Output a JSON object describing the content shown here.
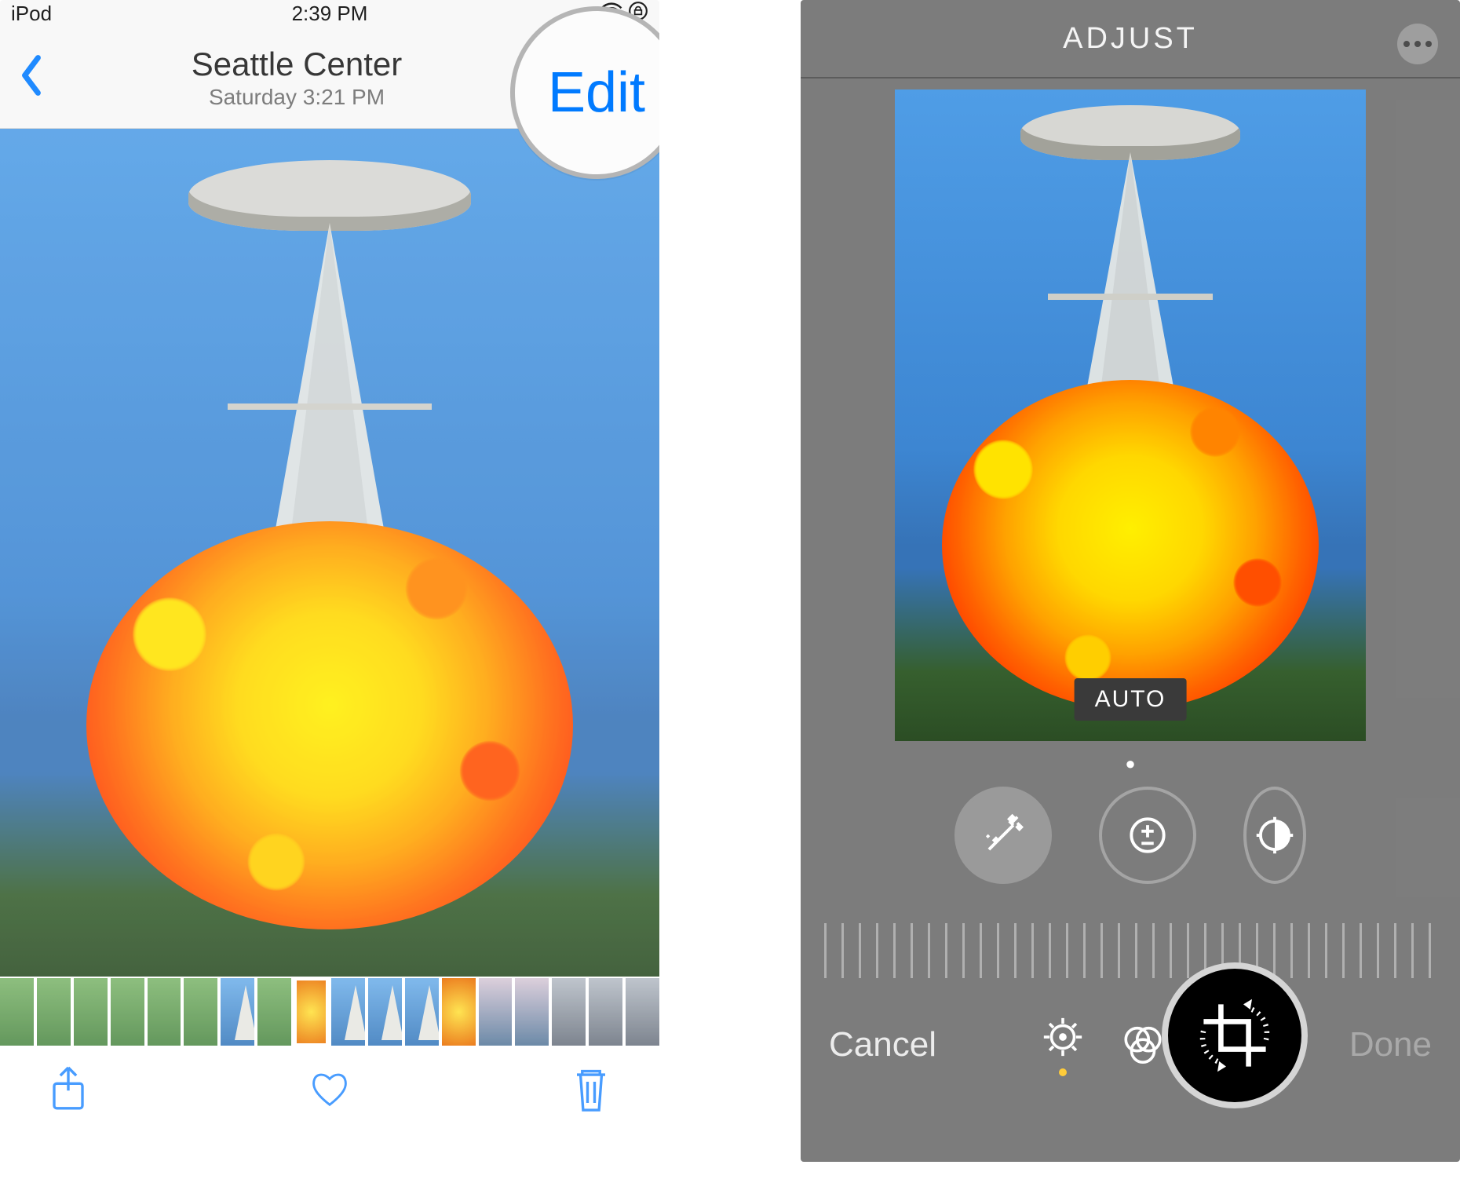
{
  "left": {
    "status": {
      "device": "iPod",
      "time": "2:39 PM"
    },
    "nav": {
      "title": "Seattle Center",
      "subtitle": "Saturday  3:21 PM",
      "edit": "Edit"
    },
    "auto_label": "",
    "thumbs_count": 18
  },
  "right": {
    "header": "ADJUST",
    "auto": "AUTO",
    "cancel": "Cancel",
    "done": "Done"
  },
  "icons": {
    "back": "chevron-left-icon",
    "wifi": "wifi-icon",
    "lock": "orientation-lock-icon",
    "share": "share-icon",
    "heart": "heart-icon",
    "trash": "trash-icon",
    "more": "more-icon",
    "wand": "magic-wand-icon",
    "exposure": "exposure-icon",
    "brightness": "brightness-icon",
    "adjust": "adjust-dial-icon",
    "filters": "filters-icon",
    "crop": "crop-rotate-icon"
  },
  "colors": {
    "ios_blue": "#007aff",
    "edit_gray_bg": "#6e6e6e",
    "active_yellow": "#ffcc3a"
  }
}
